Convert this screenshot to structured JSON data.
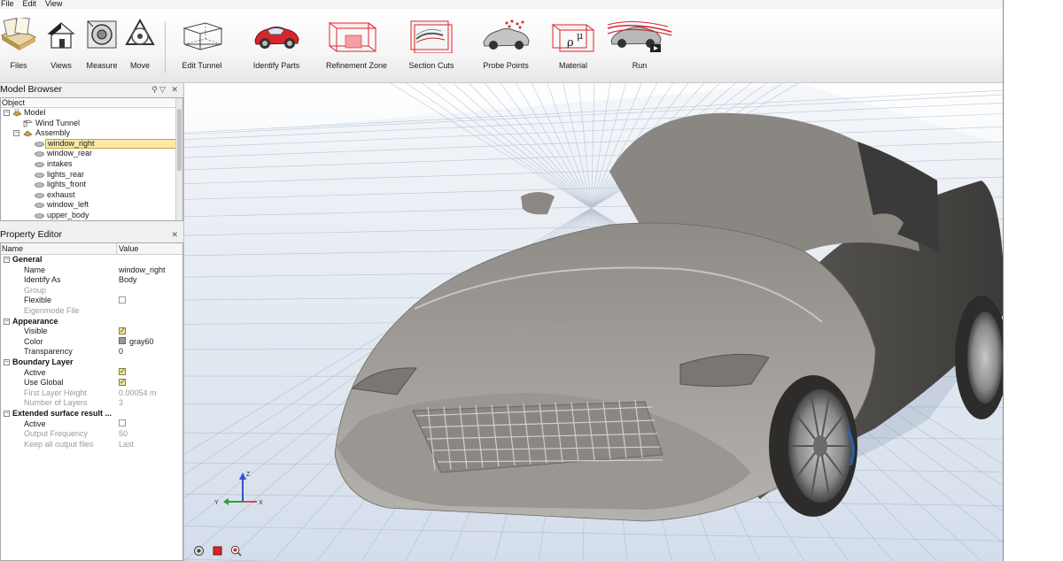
{
  "menu": [
    "File",
    "Edit",
    "View"
  ],
  "toolbar": {
    "files": "Files",
    "views": "Views",
    "measure": "Measure",
    "move": "Move",
    "edit_tunnel": "Edit Tunnel",
    "identify_parts": "Identify Parts",
    "refinement_zone": "Refinement Zone",
    "section_cuts": "Section Cuts",
    "probe_points": "Probe Points",
    "material": "Material",
    "run": "Run"
  },
  "model_browser": {
    "title": "Model Browser",
    "column": "Object",
    "items": [
      {
        "label": "Model"
      },
      {
        "label": "Wind Tunnel"
      },
      {
        "label": "Assembly"
      },
      {
        "label": "window_right"
      },
      {
        "label": "window_rear"
      },
      {
        "label": "intakes"
      },
      {
        "label": "lights_rear"
      },
      {
        "label": "lights_front"
      },
      {
        "label": "exhaust"
      },
      {
        "label": "window_left"
      },
      {
        "label": "upper_body"
      }
    ]
  },
  "property_editor": {
    "title": "Property Editor",
    "col_name": "Name",
    "col_value": "Value",
    "groups": {
      "general": {
        "label": "General",
        "name": {
          "label": "Name",
          "value": "window_right"
        },
        "identify_as": {
          "label": "Identify As",
          "value": "Body"
        },
        "group": {
          "label": "Group"
        },
        "flexible": {
          "label": "Flexible"
        },
        "eigenmode": {
          "label": "Eigenmode File"
        }
      },
      "appearance": {
        "label": "Appearance",
        "visible": {
          "label": "Visible"
        },
        "color": {
          "label": "Color",
          "value": "gray60"
        },
        "transparency": {
          "label": "Transparency",
          "value": "0"
        }
      },
      "boundary": {
        "label": "Boundary Layer",
        "active": {
          "label": "Active"
        },
        "use_global": {
          "label": "Use Global"
        },
        "first_layer": {
          "label": "First Layer Height",
          "value": "0.00054 m"
        },
        "num_layers": {
          "label": "Number of Layers",
          "value": "3"
        }
      },
      "extended": {
        "label": "Extended surface result ...",
        "active": {
          "label": "Active"
        },
        "output_freq": {
          "label": "Output Frequency",
          "value": "50"
        },
        "keep_all": {
          "label": "Keep all output files",
          "value": "Last"
        }
      }
    }
  },
  "axes": {
    "x": "X",
    "y": "Y",
    "z": "Z"
  },
  "colors": {
    "accent_red": "#d8242c",
    "selection": "#fbe9a6",
    "car_body": "#8f8c88",
    "floor_grid": "#9fb2ca"
  },
  "icons": [
    "files-icon",
    "views-icon",
    "measure-icon",
    "move-icon",
    "edit-tunnel-icon",
    "identify-parts-icon",
    "refinement-zone-icon",
    "section-cuts-icon",
    "probe-points-icon",
    "material-icon",
    "run-icon",
    "search-icon",
    "filter-icon",
    "close-icon"
  ]
}
